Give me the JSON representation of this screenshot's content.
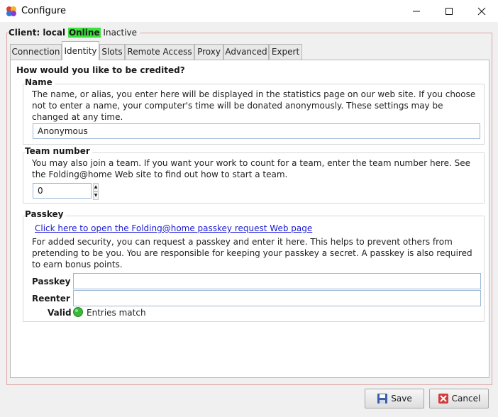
{
  "window": {
    "title": "Configure"
  },
  "status": {
    "client_label": "Client: local",
    "online": "Online",
    "inactive": "Inactive"
  },
  "tabs": [
    "Connection",
    "Identity",
    "Slots",
    "Remote Access",
    "Proxy",
    "Advanced",
    "Expert"
  ],
  "active_tab": "Identity",
  "identity": {
    "heading": "How would you like to be credited?",
    "name": {
      "title": "Name",
      "desc": "The name, or alias, you enter here will be displayed in the statistics page on our web site.  If you choose not to enter a name, your computer's time will be donated anonymously.  These settings may be changed at any time.",
      "value": "Anonymous"
    },
    "team": {
      "title": "Team number",
      "desc": "You may also join a team.  If you want your work to count for a team, enter the team number here.  See the Folding@home Web site to find out how to start a team.",
      "value": "0"
    },
    "passkey": {
      "title": "Passkey",
      "link": "Click here to open the Folding@home passkey request Web page",
      "desc": "For added security, you can request a passkey and enter it here.  This helps to prevent others from pretending to be you.  You are responsible for keeping your passkey a secret.  A passkey is also required to earn bonus points.",
      "passkey_label": "Passkey",
      "passkey_value": "",
      "reenter_label": "Reenter",
      "reenter_value": "",
      "valid_label": "Valid",
      "valid_text": "Entries match"
    }
  },
  "buttons": {
    "save": "Save",
    "cancel": "Cancel"
  },
  "colors": {
    "online_bg": "#3ee23e",
    "valid_dot": "#3bb83b",
    "link": "#1a1ad6"
  }
}
